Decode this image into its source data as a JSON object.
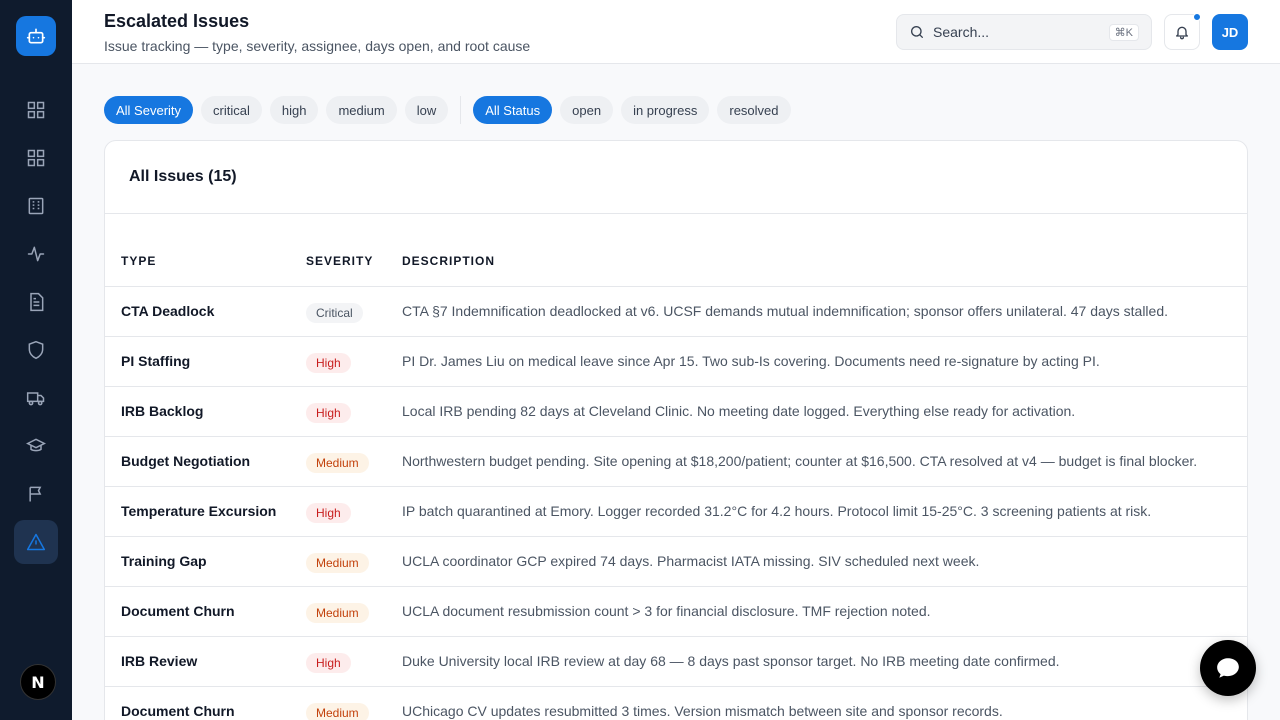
{
  "header": {
    "title": "Escalated Issues",
    "subtitle": "Issue tracking — type, severity, assignee, days open, and root cause",
    "search_placeholder": "Search...",
    "search_shortcut": "⌘K",
    "avatar_initials": "JD"
  },
  "sidebar": {
    "logo_icon": "robot-icon",
    "bottom_initial": "N",
    "items": [
      {
        "icon": "grid-icon"
      },
      {
        "icon": "grid-icon"
      },
      {
        "icon": "building-icon"
      },
      {
        "icon": "activity-icon"
      },
      {
        "icon": "document-icon"
      },
      {
        "icon": "shield-icon"
      },
      {
        "icon": "truck-icon"
      },
      {
        "icon": "graduation-cap-icon"
      },
      {
        "icon": "flag-icon"
      },
      {
        "icon": "alert-triangle-icon",
        "active": true
      }
    ]
  },
  "filters": {
    "severity": [
      "All Severity",
      "critical",
      "high",
      "medium",
      "low"
    ],
    "status": [
      "All Status",
      "open",
      "in progress",
      "resolved"
    ]
  },
  "table": {
    "title": "All Issues (15)",
    "columns": [
      "TYPE",
      "SEVERITY",
      "DESCRIPTION"
    ],
    "rows": [
      {
        "type": "CTA Deadlock",
        "severity": "Critical",
        "description": "CTA §7 Indemnification deadlocked at v6. UCSF demands mutual indemnification; sponsor offers unilateral. 47 days stalled."
      },
      {
        "type": "PI Staffing",
        "severity": "High",
        "description": "PI Dr. James Liu on medical leave since Apr 15. Two sub-Is covering. Documents need re-signature by acting PI."
      },
      {
        "type": "IRB Backlog",
        "severity": "High",
        "description": "Local IRB pending 82 days at Cleveland Clinic. No meeting date logged. Everything else ready for activation."
      },
      {
        "type": "Budget Negotiation",
        "severity": "Medium",
        "description": "Northwestern budget pending. Site opening at $18,200/patient; counter at $16,500. CTA resolved at v4 — budget is final blocker."
      },
      {
        "type": "Temperature Excursion",
        "severity": "High",
        "description": "IP batch quarantined at Emory. Logger recorded 31.2°C for 4.2 hours. Protocol limit 15-25°C. 3 screening patients at risk."
      },
      {
        "type": "Training Gap",
        "severity": "Medium",
        "description": "UCLA coordinator GCP expired 74 days. Pharmacist IATA missing. SIV scheduled next week."
      },
      {
        "type": "Document Churn",
        "severity": "Medium",
        "description": "UCLA document resubmission count > 3 for financial disclosure. TMF rejection noted."
      },
      {
        "type": "IRB Review",
        "severity": "High",
        "description": "Duke University local IRB review at day 68 — 8 days past sponsor target. No IRB meeting date confirmed."
      },
      {
        "type": "Document Churn",
        "severity": "Medium",
        "description": "UChicago CV updates resubmitted 3 times. Version mismatch between site and sponsor records."
      }
    ]
  },
  "colors": {
    "accent": "#1677e0",
    "sidebar_bg": "#0f1b2d",
    "high": "#c81e1e",
    "medium": "#c2410c"
  }
}
